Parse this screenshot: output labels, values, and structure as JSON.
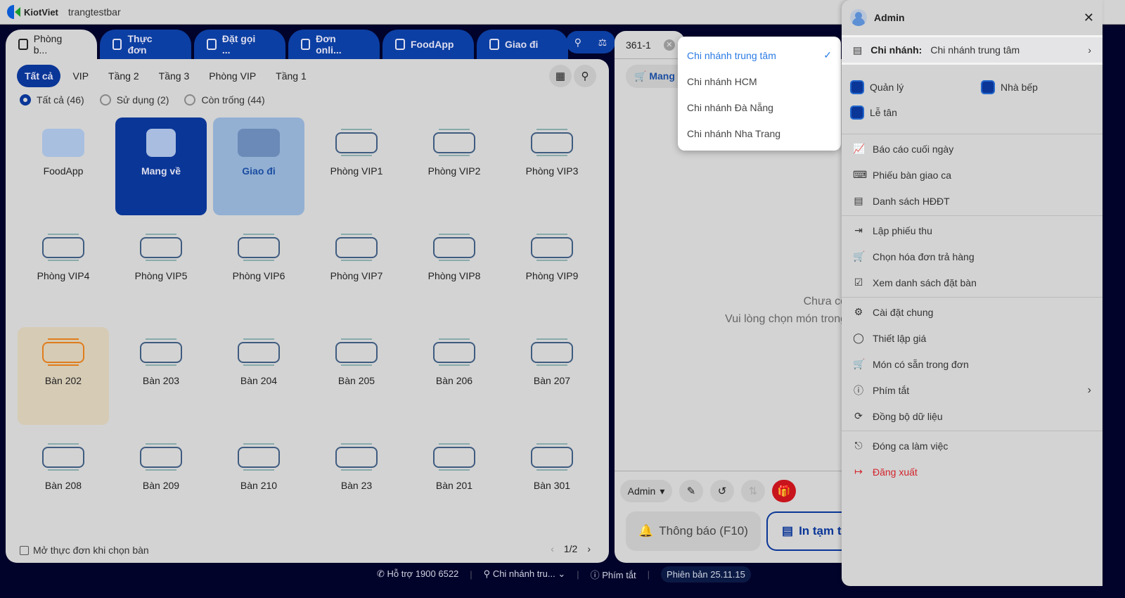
{
  "header": {
    "brand": "KiotViet",
    "store": "trangtestbar"
  },
  "tabs": [
    {
      "label": "Phòng b...",
      "active": true
    },
    {
      "label": "Thực đơn"
    },
    {
      "label": "Đặt gọi ..."
    },
    {
      "label": "Đơn onli..."
    },
    {
      "label": "FoodApp"
    },
    {
      "label": "Giao đi"
    }
  ],
  "filters": [
    "Tất cả",
    "VIP",
    "Tầng 2",
    "Tầng 3",
    "Phòng VIP",
    "Tầng 1"
  ],
  "status_filters": [
    {
      "label": "Tất cả (46)"
    },
    {
      "label": "Sử dụng (2)"
    },
    {
      "label": "Còn trống (44)"
    }
  ],
  "services": [
    "FoodApp",
    "Mang về",
    "Giao đi"
  ],
  "tables": [
    "Phòng VIP1",
    "Phòng VIP2",
    "Phòng VIP3",
    "Phòng VIP4",
    "Phòng VIP5",
    "Phòng VIP6",
    "Phòng VIP7",
    "Phòng VIP8",
    "Phòng VIP9",
    "Bàn 202",
    "Bàn 203",
    "Bàn 204",
    "Bàn 205",
    "Bàn 206",
    "Bàn 207",
    "Bàn 208",
    "Bàn 209",
    "Bàn 210",
    "Bàn 23",
    "Bàn 201",
    "Bàn 301"
  ],
  "footer": {
    "open_menu_label": "Mở thực đơn khi chọn bàn",
    "page": "1/2"
  },
  "order": {
    "tab": "361-1",
    "mode": "Mang về",
    "empty_line1": "Chưa có",
    "empty_line2": "Vui lòng chọn món trong",
    "user": "Admin",
    "notify": "Thông báo (F10)",
    "print": "In tạm tính"
  },
  "statusbar": {
    "support": "Hỗ trợ 1900 6522",
    "branch": "Chi nhánh tru...",
    "shortcuts": "Phím tắt",
    "version": "Phiên bản 25.11.15"
  },
  "branch_dropdown": [
    {
      "label": "Chi nhánh trung tâm",
      "selected": true
    },
    {
      "label": "Chi nhánh HCM"
    },
    {
      "label": "Chi nhánh Đà Nẵng"
    },
    {
      "label": "Chi nhánh Nha Trang"
    }
  ],
  "drawer": {
    "user": "Admin",
    "branch_label": "Chi nhánh:",
    "branch_value": "Chi nhánh trung tâm",
    "apps": [
      "Quản lý",
      "Nhà bếp",
      "Lễ tân"
    ],
    "sections": [
      [
        "Báo cáo cuối ngày",
        "Phiếu bàn giao ca",
        "Danh sách HĐĐT"
      ],
      [
        "Lập phiếu thu",
        "Chọn hóa đơn trả hàng",
        "Xem danh sách đặt bàn"
      ],
      [
        "Cài đặt chung",
        "Thiết lập giá",
        "Món có sẵn trong đơn",
        "Phím tắt",
        "Đồng bộ dữ liệu"
      ],
      [
        "Đóng ca làm việc",
        "Đăng xuất"
      ]
    ]
  }
}
